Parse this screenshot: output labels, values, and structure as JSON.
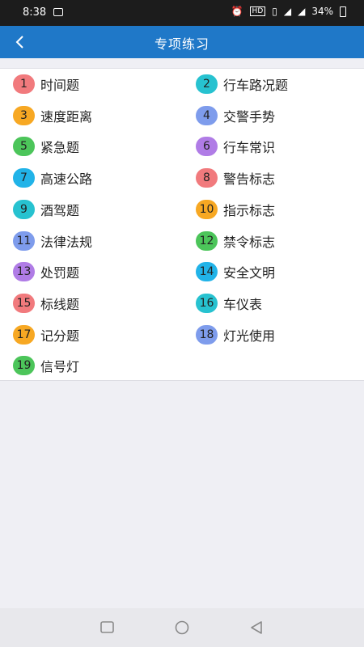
{
  "status": {
    "time": "8:38",
    "battery": "34%"
  },
  "header": {
    "title": "专项练习"
  },
  "items": [
    {
      "n": "1",
      "label": "时间题",
      "color": "#f17a7d"
    },
    {
      "n": "2",
      "label": "行车路况题",
      "color": "#27c2d0"
    },
    {
      "n": "3",
      "label": "速度距离",
      "color": "#f7a823"
    },
    {
      "n": "4",
      "label": "交警手势",
      "color": "#7e9cec"
    },
    {
      "n": "5",
      "label": "紧急题",
      "color": "#4cc55a"
    },
    {
      "n": "6",
      "label": "行车常识",
      "color": "#b07ce6"
    },
    {
      "n": "7",
      "label": "高速公路",
      "color": "#21b3e8"
    },
    {
      "n": "8",
      "label": "警告标志",
      "color": "#f17a7d"
    },
    {
      "n": "9",
      "label": "酒驾题",
      "color": "#27c2d0"
    },
    {
      "n": "10",
      "label": "指示标志",
      "color": "#f7a823"
    },
    {
      "n": "11",
      "label": "法律法规",
      "color": "#7e9cec"
    },
    {
      "n": "12",
      "label": "禁令标志",
      "color": "#4cc55a"
    },
    {
      "n": "13",
      "label": "处罚题",
      "color": "#b07ce6"
    },
    {
      "n": "14",
      "label": "安全文明",
      "color": "#21b3e8"
    },
    {
      "n": "15",
      "label": "标线题",
      "color": "#f17a7d"
    },
    {
      "n": "16",
      "label": "车仪表",
      "color": "#27c2d0"
    },
    {
      "n": "17",
      "label": "记分题",
      "color": "#f7a823"
    },
    {
      "n": "18",
      "label": "灯光使用",
      "color": "#7e9cec"
    },
    {
      "n": "19",
      "label": "信号灯",
      "color": "#4cc55a"
    }
  ]
}
